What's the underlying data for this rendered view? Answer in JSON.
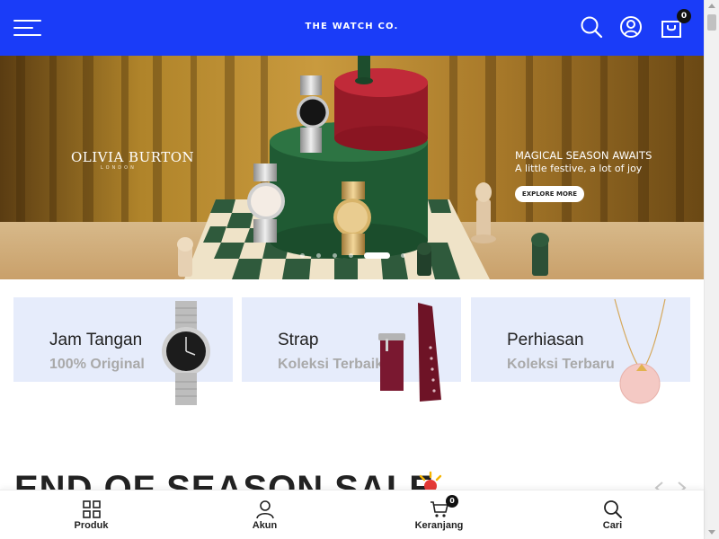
{
  "header": {
    "logo_text": "THE WATCH CO.",
    "cart_count": "0",
    "bg_color": "#1a3cf8",
    "icons": [
      "menu-icon",
      "search-icon",
      "user-icon",
      "shopping-bag-icon"
    ]
  },
  "banner": {
    "brand_name": "OLIVIA BURTON",
    "brand_location": "LONDON",
    "promo_title": "MAGICAL SEASON AWAITS",
    "promo_subtitle": "A little festive, a lot of joy",
    "cta_label": "EXPLORE MORE",
    "slide_count": 7,
    "active_slide": 5
  },
  "categories": [
    {
      "title": "Jam Tangan",
      "subtitle": "100% Original"
    },
    {
      "title": "Strap",
      "subtitle": "Koleksi Terbaik"
    },
    {
      "title": "Perhiasan",
      "subtitle": "Koleksi Terbaru"
    }
  ],
  "sale": {
    "heading": "END OF SEASON SALE"
  },
  "bottom_nav": {
    "items": [
      {
        "label": "Produk",
        "icon": "grid-icon"
      },
      {
        "label": "Akun",
        "icon": "user-icon"
      },
      {
        "label": "Keranjang",
        "icon": "cart-icon"
      },
      {
        "label": "Cari",
        "icon": "search-icon"
      }
    ],
    "cart_count": "0"
  }
}
